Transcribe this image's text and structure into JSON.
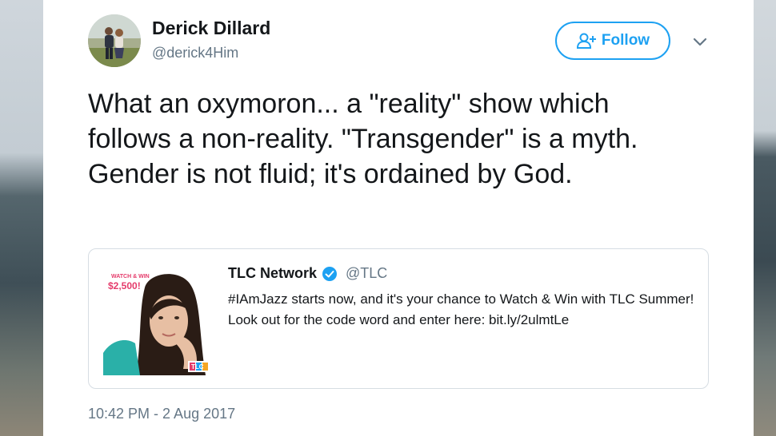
{
  "tweet": {
    "author_name": "Derick Dillard",
    "author_handle": "@derick4Him",
    "follow_label": "Follow",
    "text": "What an oxymoron... a \"reality\" show which follows a non-reality.  \"Transgender\" is a myth. Gender is not fluid; it's ordained by God.",
    "timestamp": "10:42 PM - 2 Aug 2017"
  },
  "quoted_tweet": {
    "author_name": "TLC Network",
    "author_handle": "@TLC",
    "text": "#IAmJazz starts now, and it's your chance to Watch & Win with TLC Summer! Look out for the code word and enter here: bit.ly/2ulmtLe",
    "image": {
      "prize_text": "$2,500!",
      "top_text": "WATCH & WIN",
      "network_logo": "TLC"
    }
  },
  "icons": {
    "follow": "add-user-icon",
    "menu": "chevron-down-icon",
    "verified": "verified-badge-icon"
  },
  "colors": {
    "accent": "#1da1f2",
    "text": "#14171a",
    "secondary_text": "#657786",
    "prize": "#e53b6b"
  }
}
